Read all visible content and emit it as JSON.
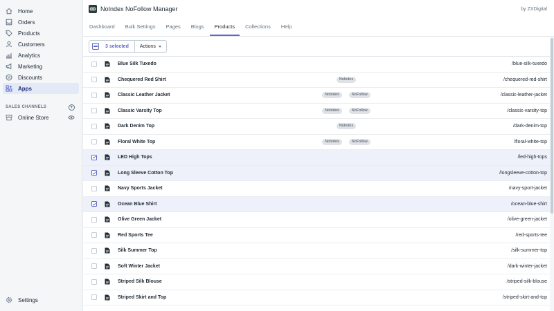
{
  "sidebar": {
    "items": [
      {
        "label": "Home",
        "icon": "home-icon"
      },
      {
        "label": "Orders",
        "icon": "orders-icon"
      },
      {
        "label": "Products",
        "icon": "tag-icon"
      },
      {
        "label": "Customers",
        "icon": "person-icon"
      },
      {
        "label": "Analytics",
        "icon": "bar-chart-icon"
      },
      {
        "label": "Marketing",
        "icon": "megaphone-icon"
      },
      {
        "label": "Discounts",
        "icon": "discount-icon"
      },
      {
        "label": "Apps",
        "icon": "apps-icon",
        "active": true
      }
    ],
    "sales_channels_title": "SALES CHANNELS",
    "online_store": "Online Store",
    "settings": "Settings"
  },
  "header": {
    "app_title": "NoIndex NoFollow Manager",
    "by": "by ZXDigital"
  },
  "tabs": [
    {
      "label": "Dashboard"
    },
    {
      "label": "Bulk Settings"
    },
    {
      "label": "Pages"
    },
    {
      "label": "Blogs"
    },
    {
      "label": "Products",
      "active": true
    },
    {
      "label": "Collections"
    },
    {
      "label": "Help"
    }
  ],
  "bulk": {
    "selected_label": "3 selected",
    "actions_label": "Actions"
  },
  "products": [
    {
      "title": "Blue Silk Tuxedo",
      "handle": "/blue-silk-tuxedo",
      "badges": [],
      "selected": false
    },
    {
      "title": "Chequered Red Shirt",
      "handle": "/chequered-red-shirt",
      "badges": [
        "NoIndex"
      ],
      "selected": false
    },
    {
      "title": "Classic Leather Jacket",
      "handle": "/classic-leather-jacket",
      "badges": [
        "NoIndex",
        "NoFollow"
      ],
      "selected": false
    },
    {
      "title": "Classic Varsity Top",
      "handle": "/classic-varsity-top",
      "badges": [
        "NoIndex",
        "NoFollow"
      ],
      "selected": false
    },
    {
      "title": "Dark Denim Top",
      "handle": "/dark-denim-top",
      "badges": [
        "NoIndex"
      ],
      "selected": false
    },
    {
      "title": "Floral White Top",
      "handle": "/floral-white-top",
      "badges": [
        "NoIndex",
        "NoFollow"
      ],
      "selected": false
    },
    {
      "title": "LED High Tops",
      "handle": "/led-high-tops",
      "badges": [],
      "selected": true
    },
    {
      "title": "Long Sleeve Cotton Top",
      "handle": "/longsleeve-cotton-top",
      "badges": [],
      "selected": true
    },
    {
      "title": "Navy Sports Jacket",
      "handle": "/navy-sport-jacket",
      "badges": [],
      "selected": false
    },
    {
      "title": "Ocean Blue Shirt",
      "handle": "/ocean-blue-shirt",
      "badges": [],
      "selected": true
    },
    {
      "title": "Olive Green Jacket",
      "handle": "/olive-green-jacket",
      "badges": [],
      "selected": false
    },
    {
      "title": "Red Sports Tee",
      "handle": "/red-sports-tee",
      "badges": [],
      "selected": false
    },
    {
      "title": "Silk Summer Top",
      "handle": "/silk-summer-top",
      "badges": [],
      "selected": false
    },
    {
      "title": "Soft Winter Jacket",
      "handle": "/dark-winter-jacket",
      "badges": [],
      "selected": false
    },
    {
      "title": "Striped Silk Blouse",
      "handle": "/striped-silk-blouse",
      "badges": [],
      "selected": false
    },
    {
      "title": "Striped Skirt and Top",
      "handle": "/striped-skirt-and-top",
      "badges": [],
      "selected": false
    }
  ],
  "colors": {
    "accent": "#5c6ac4",
    "selected_row": "#eef1f9",
    "sidebar_bg": "#f4f6f8",
    "active_nav": "#e3e9f7"
  }
}
